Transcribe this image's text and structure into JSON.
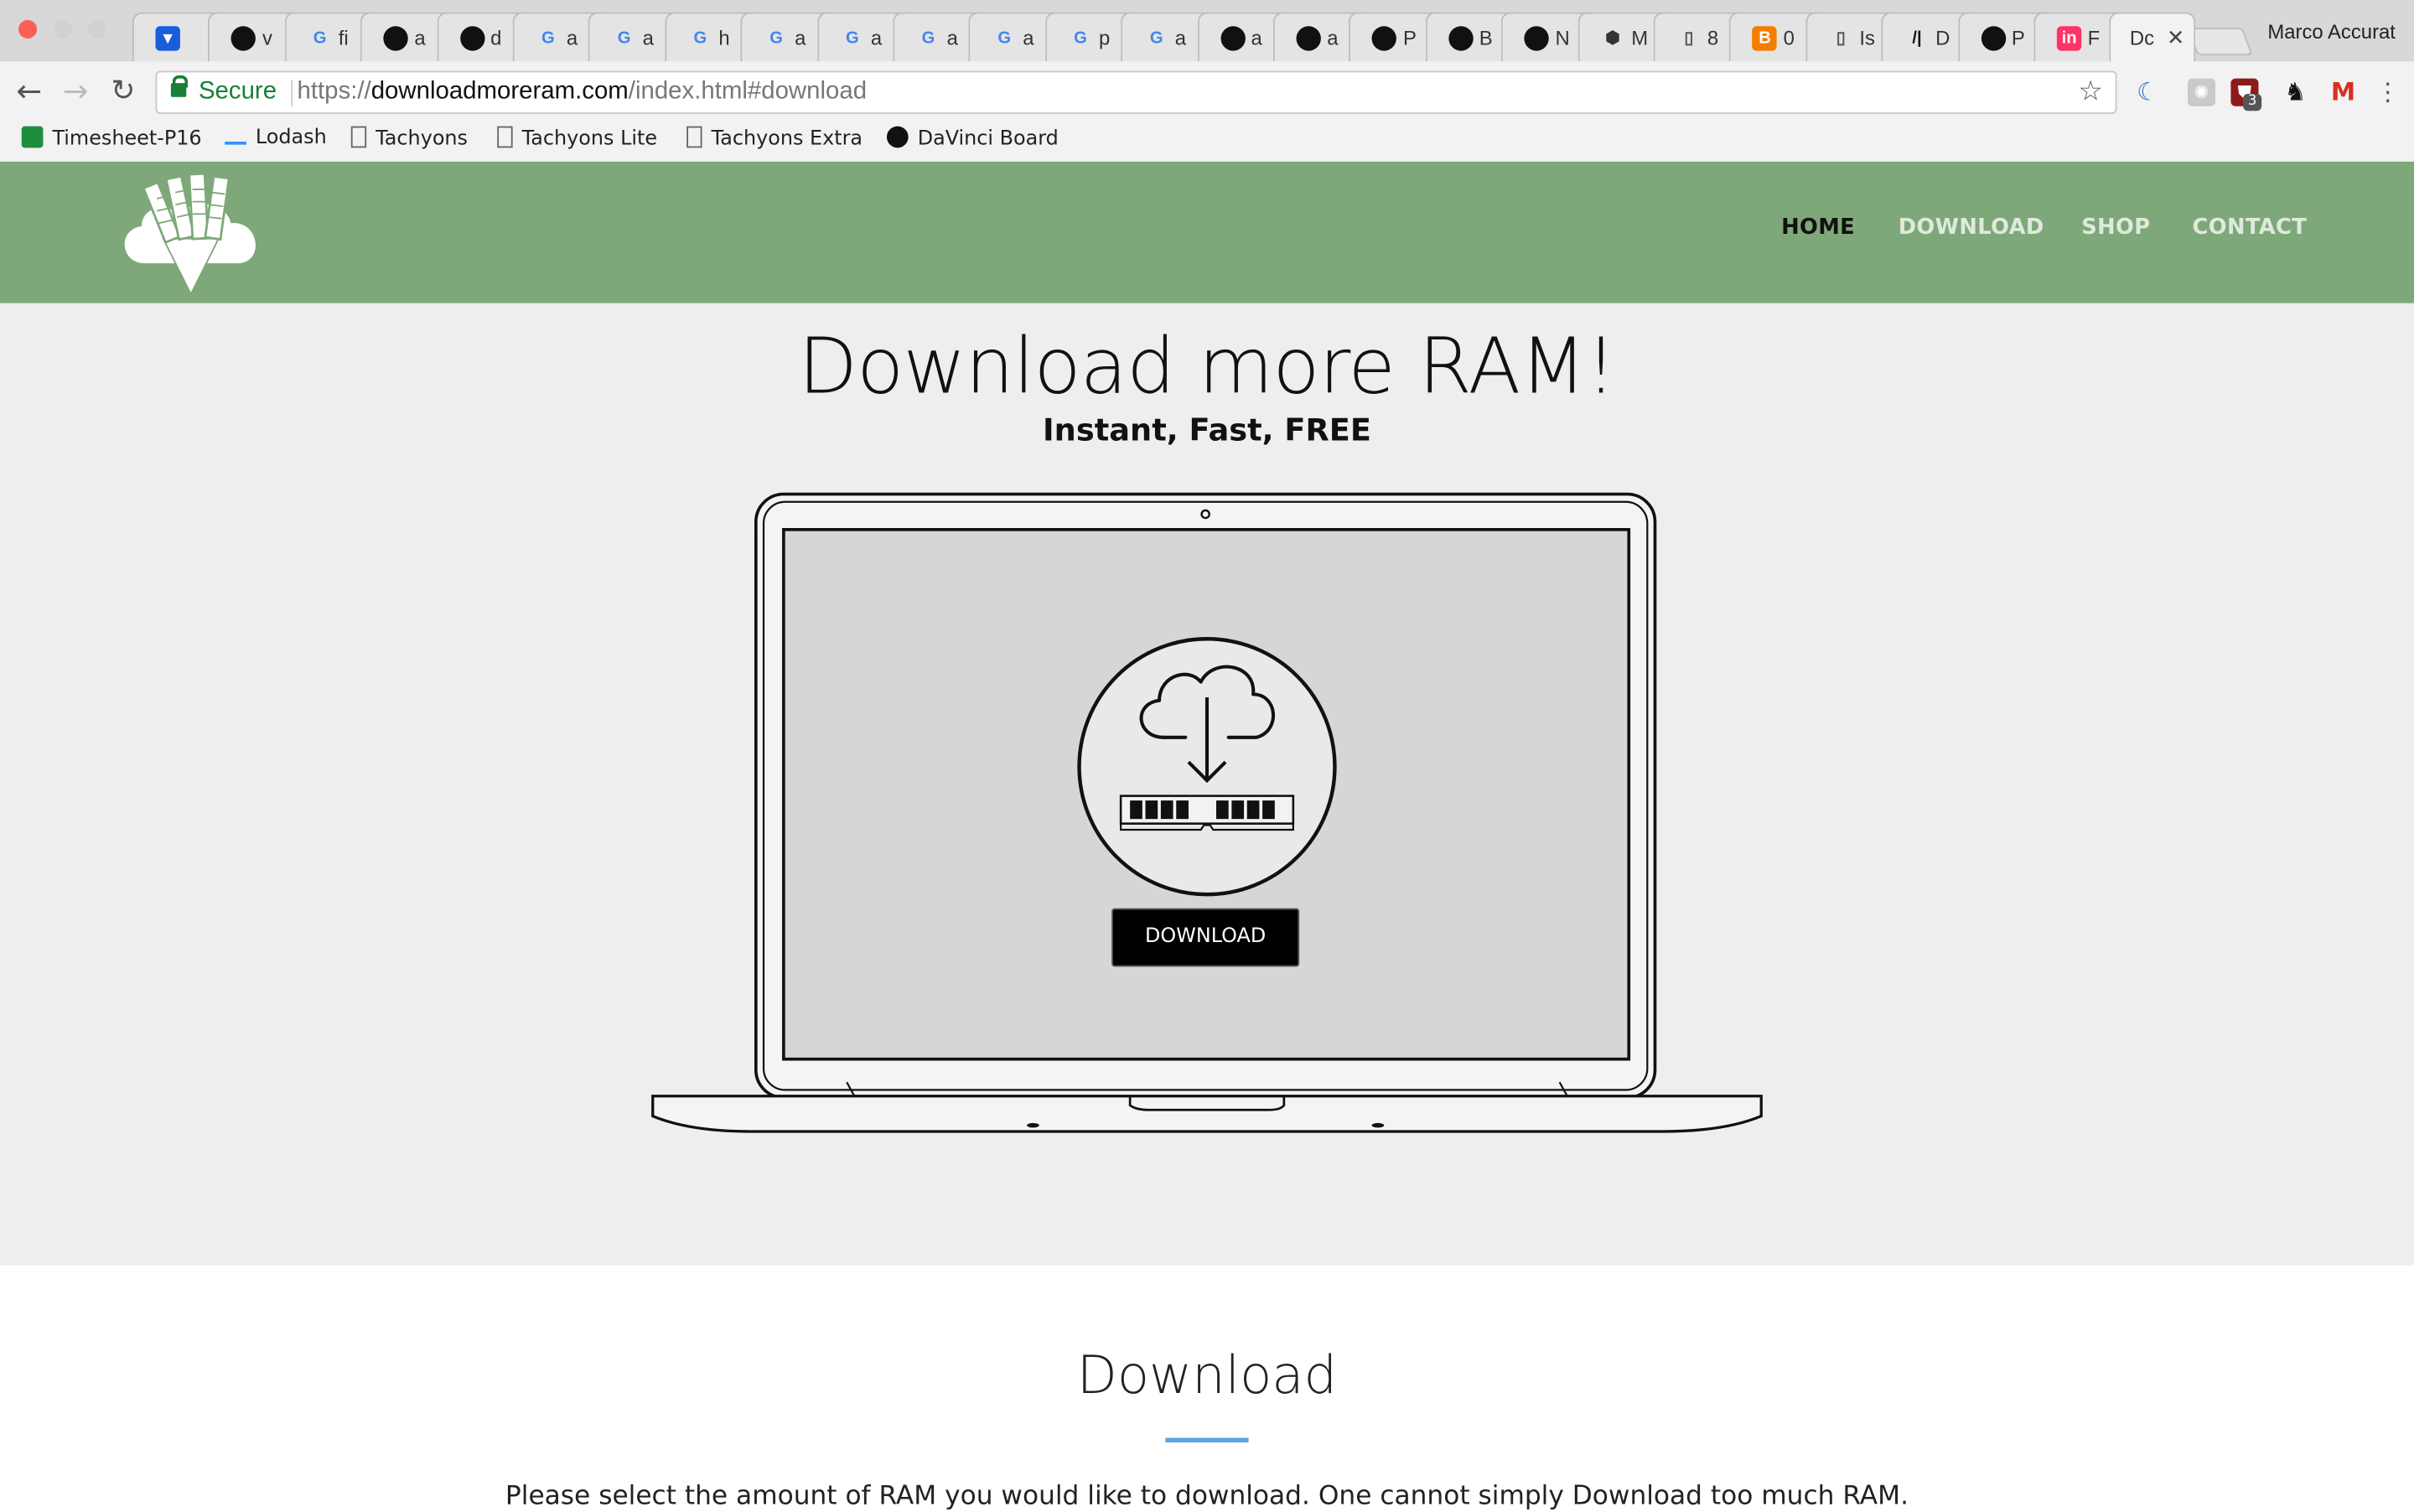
{
  "browser": {
    "profile_name": "Marco Accurat",
    "tabs": [
      {
        "icon": "bitwarden-icon",
        "label": ""
      },
      {
        "icon": "github-icon",
        "label": "v"
      },
      {
        "icon": "google-icon",
        "label": "fi"
      },
      {
        "icon": "github-icon",
        "label": "a"
      },
      {
        "icon": "github-icon",
        "label": "d"
      },
      {
        "icon": "google-icon",
        "label": "a"
      },
      {
        "icon": "google-icon",
        "label": "a"
      },
      {
        "icon": "google-icon",
        "label": "h"
      },
      {
        "icon": "google-icon",
        "label": "a"
      },
      {
        "icon": "google-icon",
        "label": "a"
      },
      {
        "icon": "google-icon",
        "label": "a"
      },
      {
        "icon": "google-icon",
        "label": "a"
      },
      {
        "icon": "google-icon",
        "label": "p"
      },
      {
        "icon": "google-icon",
        "label": "a"
      },
      {
        "icon": "github-icon",
        "label": "a"
      },
      {
        "icon": "github-icon",
        "label": "a"
      },
      {
        "icon": "github-icon",
        "label": "P"
      },
      {
        "icon": "github-icon",
        "label": "B"
      },
      {
        "icon": "github-icon",
        "label": "N"
      },
      {
        "icon": "cube-icon",
        "label": "M"
      },
      {
        "icon": "page-icon",
        "label": "8"
      },
      {
        "icon": "blogger-icon",
        "label": "0"
      },
      {
        "icon": "page-icon",
        "label": "Is"
      },
      {
        "icon": "slash-icon",
        "label": "D"
      },
      {
        "icon": "github-icon",
        "label": "P"
      },
      {
        "icon": "invision-icon",
        "label": "F"
      }
    ],
    "active_tab": {
      "label": "Dc"
    },
    "address": {
      "secure_label": "Secure",
      "scheme": "https://",
      "host": "downloadmoreram.com",
      "path": "/index.html#download"
    },
    "bookmarks": [
      {
        "icon": "sheets-icon",
        "label": "Timesheet-P16"
      },
      {
        "icon": "lodash-icon",
        "label": "Lodash"
      },
      {
        "icon": "page-icon",
        "label": "Tachyons"
      },
      {
        "icon": "page-icon",
        "label": "Tachyons Lite"
      },
      {
        "icon": "page-icon",
        "label": "Tachyons Extra"
      },
      {
        "icon": "github-icon",
        "label": "DaVinci Board"
      }
    ],
    "extension_badge": "3"
  },
  "site": {
    "nav": [
      {
        "label": "HOME",
        "active": true
      },
      {
        "label": "DOWNLOAD",
        "active": false
      },
      {
        "label": "SHOP",
        "active": false
      },
      {
        "label": "CONTACT",
        "active": false
      }
    ],
    "hero": {
      "title": "Download more RAM!",
      "subtitle": "Instant, Fast, FREE",
      "button_label": "DOWNLOAD"
    },
    "section": {
      "title": "Download",
      "text": "Please select the amount of RAM you would like to download. One cannot simply Download too much RAM."
    },
    "colors": {
      "header_green": "#7ea87a",
      "hero_bg": "#eeeeee",
      "accent_rule": "#5aa6e6"
    }
  }
}
